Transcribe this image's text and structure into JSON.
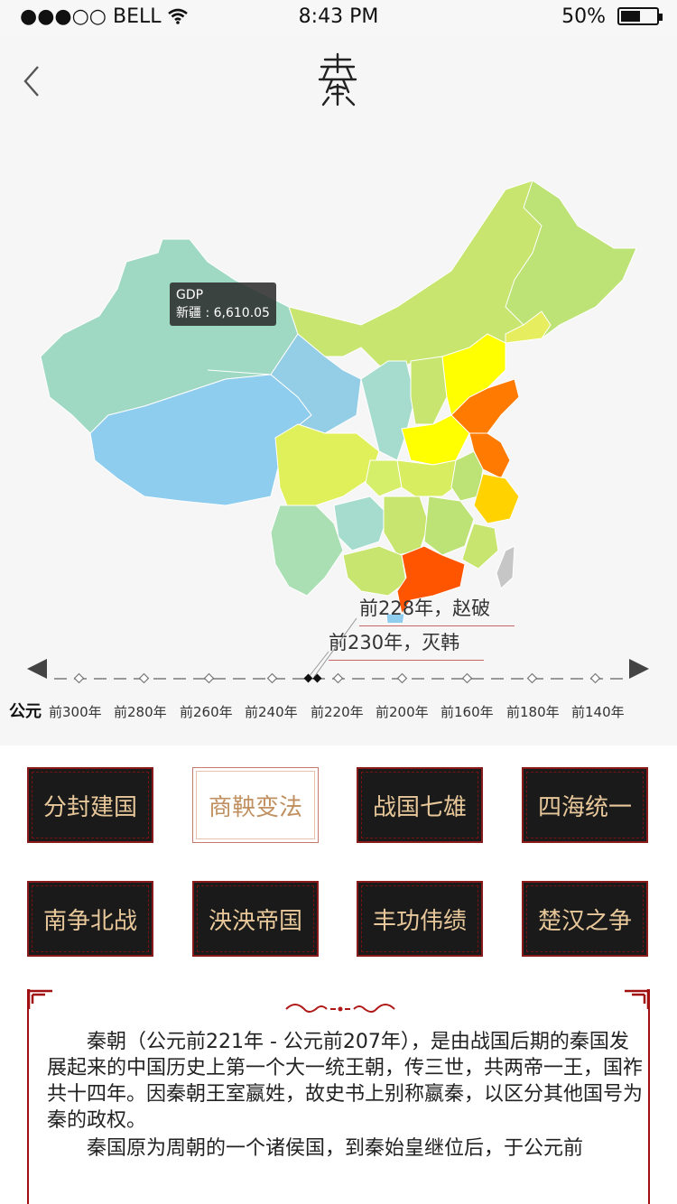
{
  "status_bar": {
    "carrier": "●●●○○ BELL",
    "time": "8:43 PM",
    "battery": "50%"
  },
  "header": {
    "logo_name": "qin-seal-logo"
  },
  "map": {
    "tooltip": {
      "title": "GDP",
      "text": "新疆 : 6,610.05"
    },
    "colors": {
      "low": "#8fcdef",
      "mid": "#c7e56f",
      "yellow": "#ffff00",
      "orange": "#ff7a00",
      "red": "#ff5500",
      "taiwan": "#c6c6c6"
    }
  },
  "timeline": {
    "annotations": [
      "前228年，赵破",
      "前230年，灭韩"
    ],
    "era_label": "公元",
    "ticks": [
      "前300年",
      "前280年",
      "前260年",
      "前240年",
      "前220年",
      "前200年",
      "前160年",
      "前180年",
      "前140年"
    ]
  },
  "topics": [
    {
      "label": "分封建国",
      "active": false
    },
    {
      "label": "商鞅变法",
      "active": true
    },
    {
      "label": "战国七雄",
      "active": false
    },
    {
      "label": "四海统一",
      "active": false
    },
    {
      "label": "南争北战",
      "active": false
    },
    {
      "label": "泱泱帝国",
      "active": false
    },
    {
      "label": "丰功伟绩",
      "active": false
    },
    {
      "label": "楚汉之争",
      "active": false
    }
  ],
  "article": {
    "p1": "秦朝（公元前221年 - 公元前207年），是由战国后期的秦国发展起来的中国历史上第一个大一统王朝，传三世，共两帝一王，国祚共十四年。因秦朝王室嬴姓，故史书上别称嬴秦，以区分其他国号为秦的政权。",
    "p2": "秦国原为周朝的一个诸侯国，到秦始皇继位后，于公元前"
  }
}
